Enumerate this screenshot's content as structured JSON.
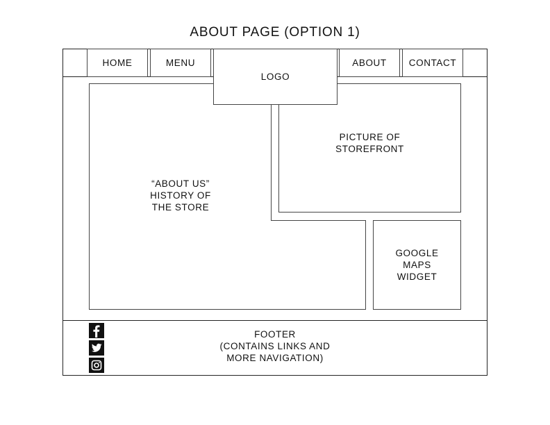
{
  "title": "ABOUT PAGE (OPTION 1)",
  "nav": {
    "home": "HOME",
    "menu": "MENU",
    "logo": "LOGO",
    "about": "ABOUT",
    "contact": "CONTACT"
  },
  "content": {
    "about_us": "“ABOUT US”\nHISTORY OF\nTHE STORE",
    "storefront": "PICTURE OF\nSTOREFRONT",
    "maps": "GOOGLE\nMAPS\nWIDGET"
  },
  "footer": {
    "text": "FOOTER\n(CONTAINS LINKS AND\nMORE NAVIGATION)",
    "icons": [
      "facebook-icon",
      "twitter-icon",
      "instagram-icon"
    ]
  }
}
